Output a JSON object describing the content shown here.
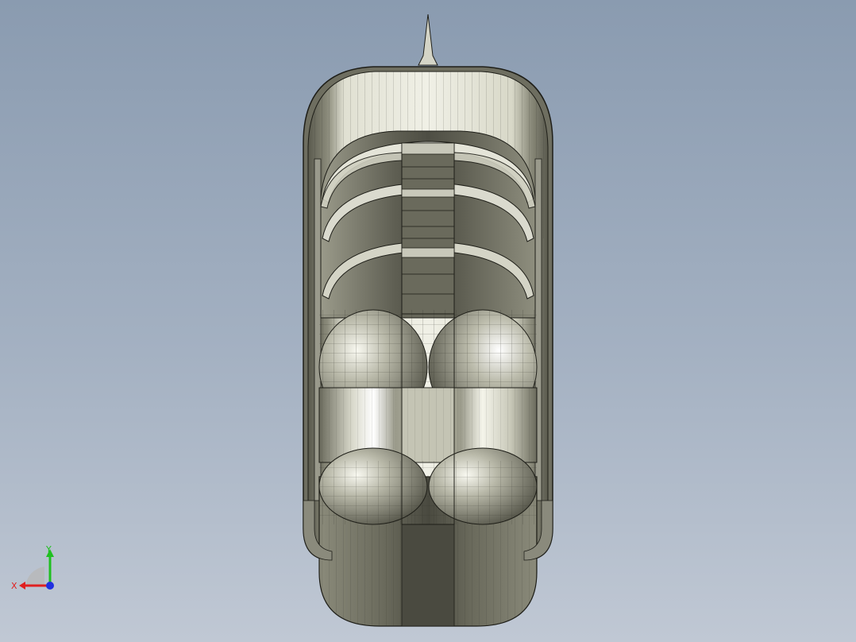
{
  "viewport": {
    "background_top": "#8a9bb0",
    "background_bottom": "#c0c8d4",
    "model_colors": {
      "outer_shell": "#6e6e60",
      "shell_light": "#e8e8dc",
      "interior_dark": "#55554a",
      "sphere_light": "#f4f4ea",
      "edge": "#1e1e18"
    }
  },
  "triad": {
    "x_label": "X",
    "y_label": "Y",
    "x_color": "#e02020",
    "y_color": "#20c020",
    "z_color": "#2030e0"
  }
}
